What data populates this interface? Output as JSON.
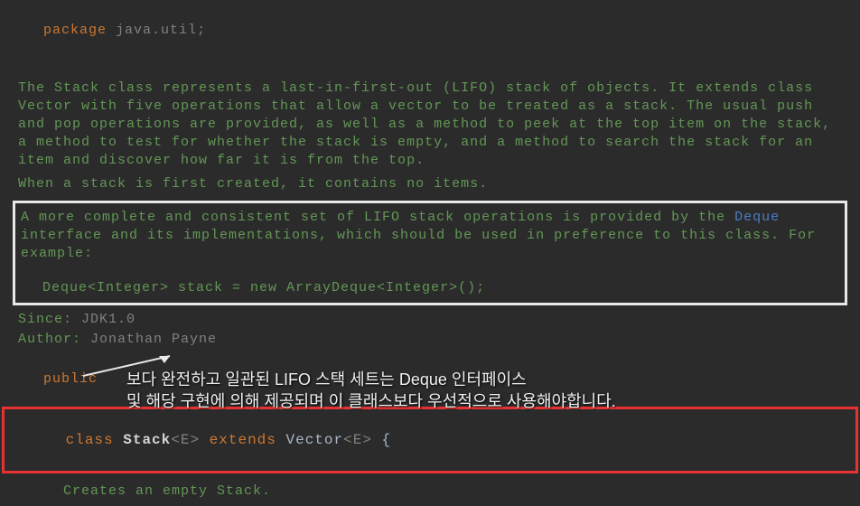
{
  "package": {
    "keyword": "package",
    "name": "java.util",
    "semicolon": ";"
  },
  "javadoc": {
    "para1": "The Stack class represents a last-in-first-out (LIFO) stack of objects. It extends class Vector with five operations that allow a vector to be treated as a stack. The usual push and pop operations are provided, as well as a method to peek at the top item on the stack, a method to test for whether the stack is empty, and a method to search the stack for an item and discover how far it is from the top.",
    "para2": "When a stack is first created, it contains no items.",
    "highlighted": {
      "text_before": "A more complete and consistent set of LIFO stack operations is provided by the ",
      "link": "Deque",
      "text_after": " interface and its implementations, which should be used in preference to this class. For example:",
      "example": "  Deque<Integer> stack = new ArrayDeque<Integer>();"
    },
    "since": {
      "label": "Since:",
      "value": "JDK1.0"
    },
    "author": {
      "label": "Author:",
      "value": "Jonathan Payne"
    }
  },
  "decl": {
    "public": "public",
    "class_kw": "class",
    "class_name": "Stack",
    "generic1": "<E>",
    "extends_kw": "extends",
    "super_name": "Vector",
    "generic2": "<E>",
    "brace": "{"
  },
  "inner_doc": "Creates an empty Stack.",
  "overlay": {
    "line1": "보다 완전하고 일관된 LIFO 스택 세트는 Deque 인터페이스",
    "line2": "및 해당 구현에 의해 제공되며 이 클래스보다 우선적으로 사용해야합니다."
  }
}
